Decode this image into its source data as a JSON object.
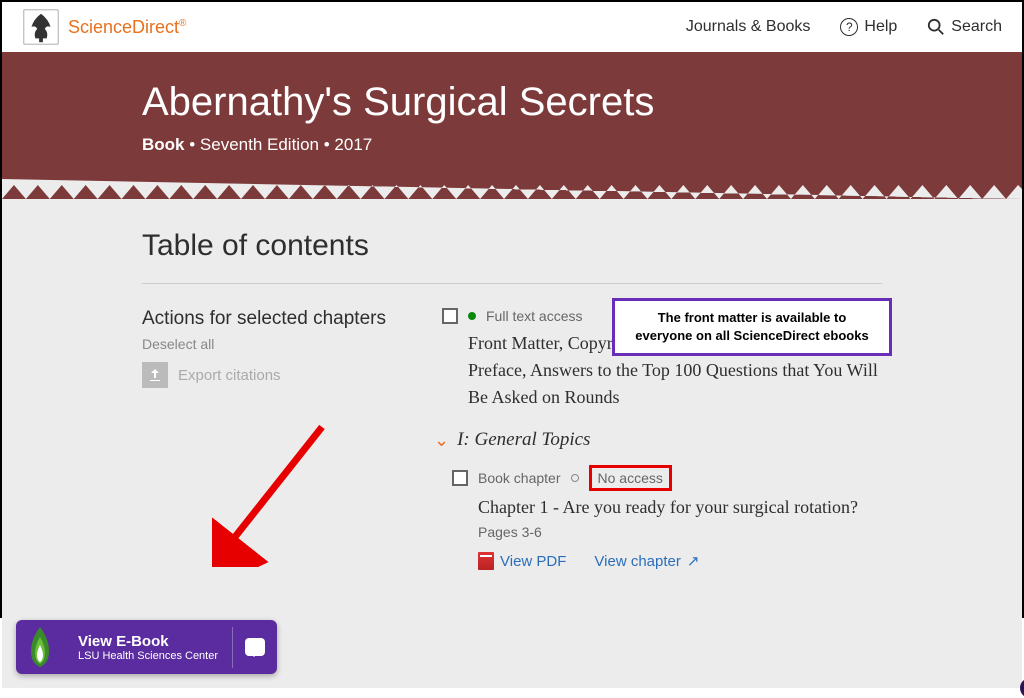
{
  "topbar": {
    "brand": "ScienceDirect",
    "nav": {
      "journals": "Journals & Books",
      "help": "Help",
      "search": "Search"
    }
  },
  "hero": {
    "title": "Abernathy's Surgical Secrets",
    "book": "Book",
    "edition": "Seventh Edition",
    "year": "2017"
  },
  "toc": {
    "heading": "Table of contents",
    "actions_title": "Actions for selected chapters",
    "deselect": "Deselect all",
    "export": "Export citations",
    "full_text_access": "Full text access",
    "front_matter": "Front Matter, Copyright, Dedication, Contributors, Preface, Answers to the Top 100 Questions that You Will Be Asked on Rounds",
    "section1": "I: General Topics",
    "book_chapter": "Book chapter",
    "no_access": "No access",
    "chapter1": "Chapter 1 - Are you ready for your surgical rotation?",
    "pages1": "Pages 3-6",
    "view_pdf": "View PDF",
    "view_chapter": "View chapter"
  },
  "annotations": {
    "purple": "The front matter is available to everyone on all ScienceDirect ebooks"
  },
  "ebook_widget": {
    "title": "View E-Book",
    "subtitle": "LSU Health Sciences Center"
  }
}
